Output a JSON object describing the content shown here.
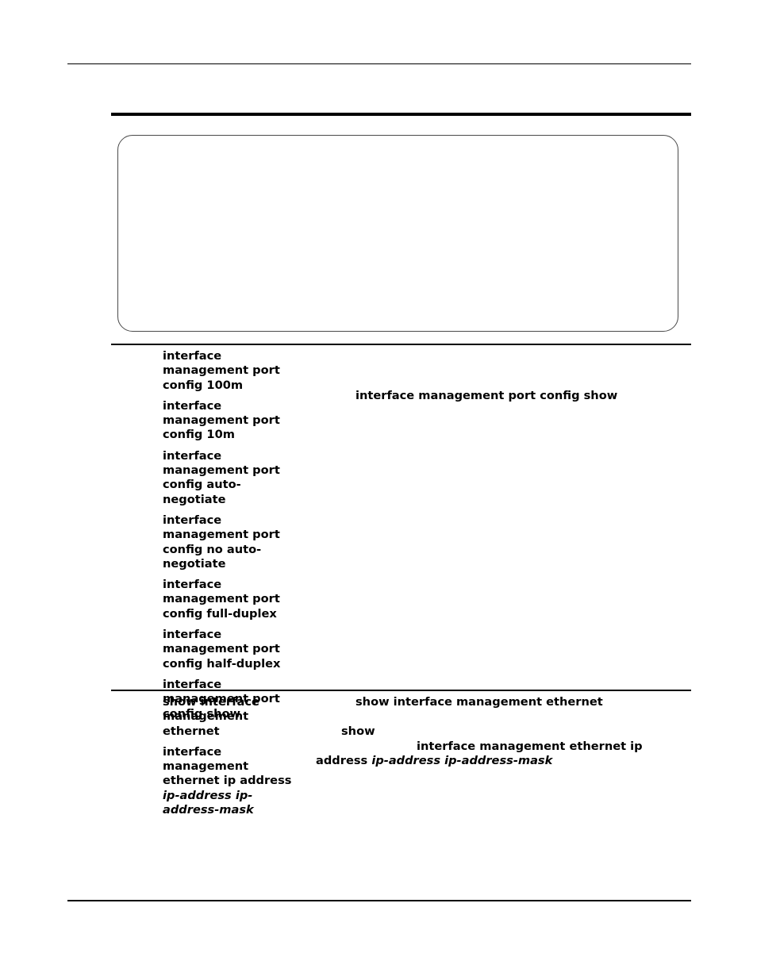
{
  "page": {
    "layout": "two-column command reference table",
    "callout_box": {
      "present": true,
      "content": ""
    }
  },
  "table": {
    "rows": [
      {
        "id": "row-port-config",
        "left_paragraphs": [
          "interface management port config 100m",
          "interface management port config 10m",
          "interface management port config auto-negotiate",
          "interface management port config no auto-negotiate",
          "interface management port config full-duplex",
          "interface management port config half-duplex",
          "interface management port config show"
        ],
        "right_lines": [
          {
            "text": "interface management port config show",
            "style": "bold"
          }
        ]
      },
      {
        "id": "row-show-ethernet",
        "left_paragraphs": [
          "show interface management ethernet",
          "interface management ethernet ip address ip-address ip-address-mask"
        ],
        "left_italic_tokens": [
          "ip-address",
          "ip-address-mask"
        ],
        "right_lines": [
          {
            "text": "show interface management ethernet",
            "style": "bold"
          },
          {
            "text": "show",
            "style": "bold"
          },
          {
            "text": "interface management ethernet ip",
            "style": "bold"
          },
          {
            "text": "address",
            "style": "bold"
          },
          {
            "text": "ip-address ip-address-mask",
            "style": "bold-italic"
          }
        ]
      }
    ]
  }
}
